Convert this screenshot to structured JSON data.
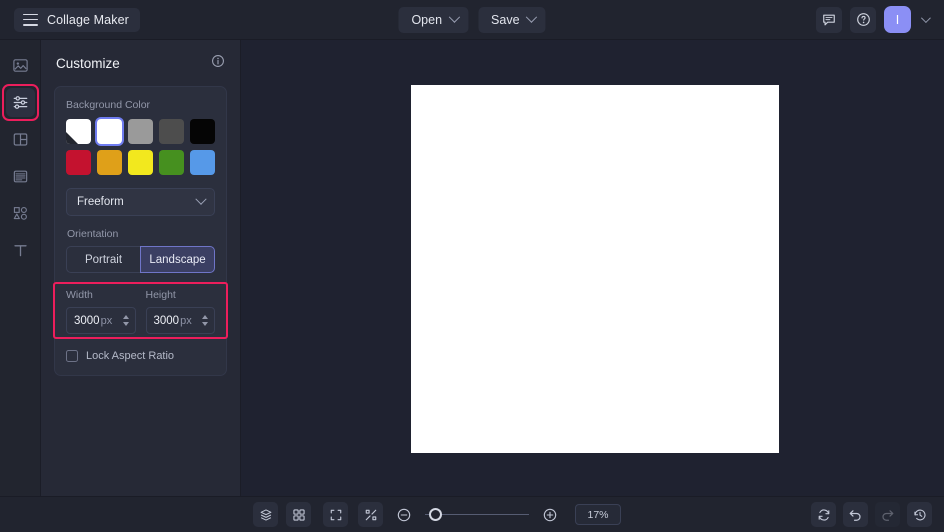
{
  "app": {
    "title": "Collage Maker",
    "accent_purple": "#8b8ff5",
    "highlight_pink": "#ec1e5c",
    "canvas_color": "#ffffff",
    "panel_bg": "#262936",
    "topbar_bg": "#21242f"
  },
  "topbar": {
    "menu_icon": "hamburger-icon",
    "open_label": "Open",
    "save_label": "Save",
    "feedback_icon": "chat-bubble-icon",
    "help_icon": "help-circle-icon",
    "avatar_initial": "I"
  },
  "rail": {
    "items": [
      {
        "name": "images",
        "icon": "image-icon",
        "active": false
      },
      {
        "name": "customize",
        "icon": "sliders-icon",
        "active": true
      },
      {
        "name": "layout",
        "icon": "layout-grid-icon",
        "active": false
      },
      {
        "name": "layers",
        "icon": "layers-stack-icon",
        "active": false
      },
      {
        "name": "shapes",
        "icon": "shapes-icon",
        "active": false
      },
      {
        "name": "text",
        "icon": "text-t-icon",
        "active": false
      }
    ]
  },
  "panel": {
    "title": "Customize",
    "info_icon": "info-circle-icon",
    "background_color": {
      "label": "Background Color",
      "row1": [
        {
          "name": "custom",
          "hex": "#ffffff",
          "selected": false,
          "custom": true
        },
        {
          "name": "white",
          "hex": "#ffffff",
          "selected": true,
          "custom": false
        },
        {
          "name": "light-gray",
          "hex": "#9a9a9a",
          "selected": false,
          "custom": false
        },
        {
          "name": "dark-gray",
          "hex": "#4d4d4d",
          "selected": false,
          "custom": false
        },
        {
          "name": "black",
          "hex": "#050505",
          "selected": false,
          "custom": false
        }
      ],
      "row2": [
        {
          "name": "red",
          "hex": "#c4122f",
          "selected": false,
          "custom": false
        },
        {
          "name": "amber",
          "hex": "#dfa019",
          "selected": false,
          "custom": false
        },
        {
          "name": "yellow",
          "hex": "#f2e81e",
          "selected": false,
          "custom": false
        },
        {
          "name": "green",
          "hex": "#46901f",
          "selected": false,
          "custom": false
        },
        {
          "name": "blue",
          "hex": "#5699e8",
          "selected": false,
          "custom": false
        }
      ]
    },
    "preset": {
      "value": "Freeform",
      "options": [
        "Freeform"
      ]
    },
    "orientation": {
      "label": "Orientation",
      "portrait_label": "Portrait",
      "landscape_label": "Landscape",
      "selected": "Landscape"
    },
    "dimensions": {
      "width_label": "Width",
      "height_label": "Height",
      "width_value": "3000",
      "height_value": "3000",
      "unit": "px",
      "highlighted": true
    },
    "lock_aspect": {
      "label": "Lock Aspect Ratio",
      "checked": false
    }
  },
  "bottombar": {
    "layers_icon": "layers-stack-icon",
    "grid_icon": "grid-four-icon",
    "fullscreen_icon": "expand-frame-icon",
    "fit_icon": "collapse-arrows-icon",
    "zoom_out_icon": "minus-circle-icon",
    "zoom_in_icon": "plus-circle-icon",
    "zoom_value": "17%",
    "zoom_slider_percent": 8,
    "reset_icon": "refresh-icon",
    "undo_icon": "undo-arrow-icon",
    "redo_icon": "redo-arrow-icon",
    "history_icon": "clock-history-icon"
  }
}
